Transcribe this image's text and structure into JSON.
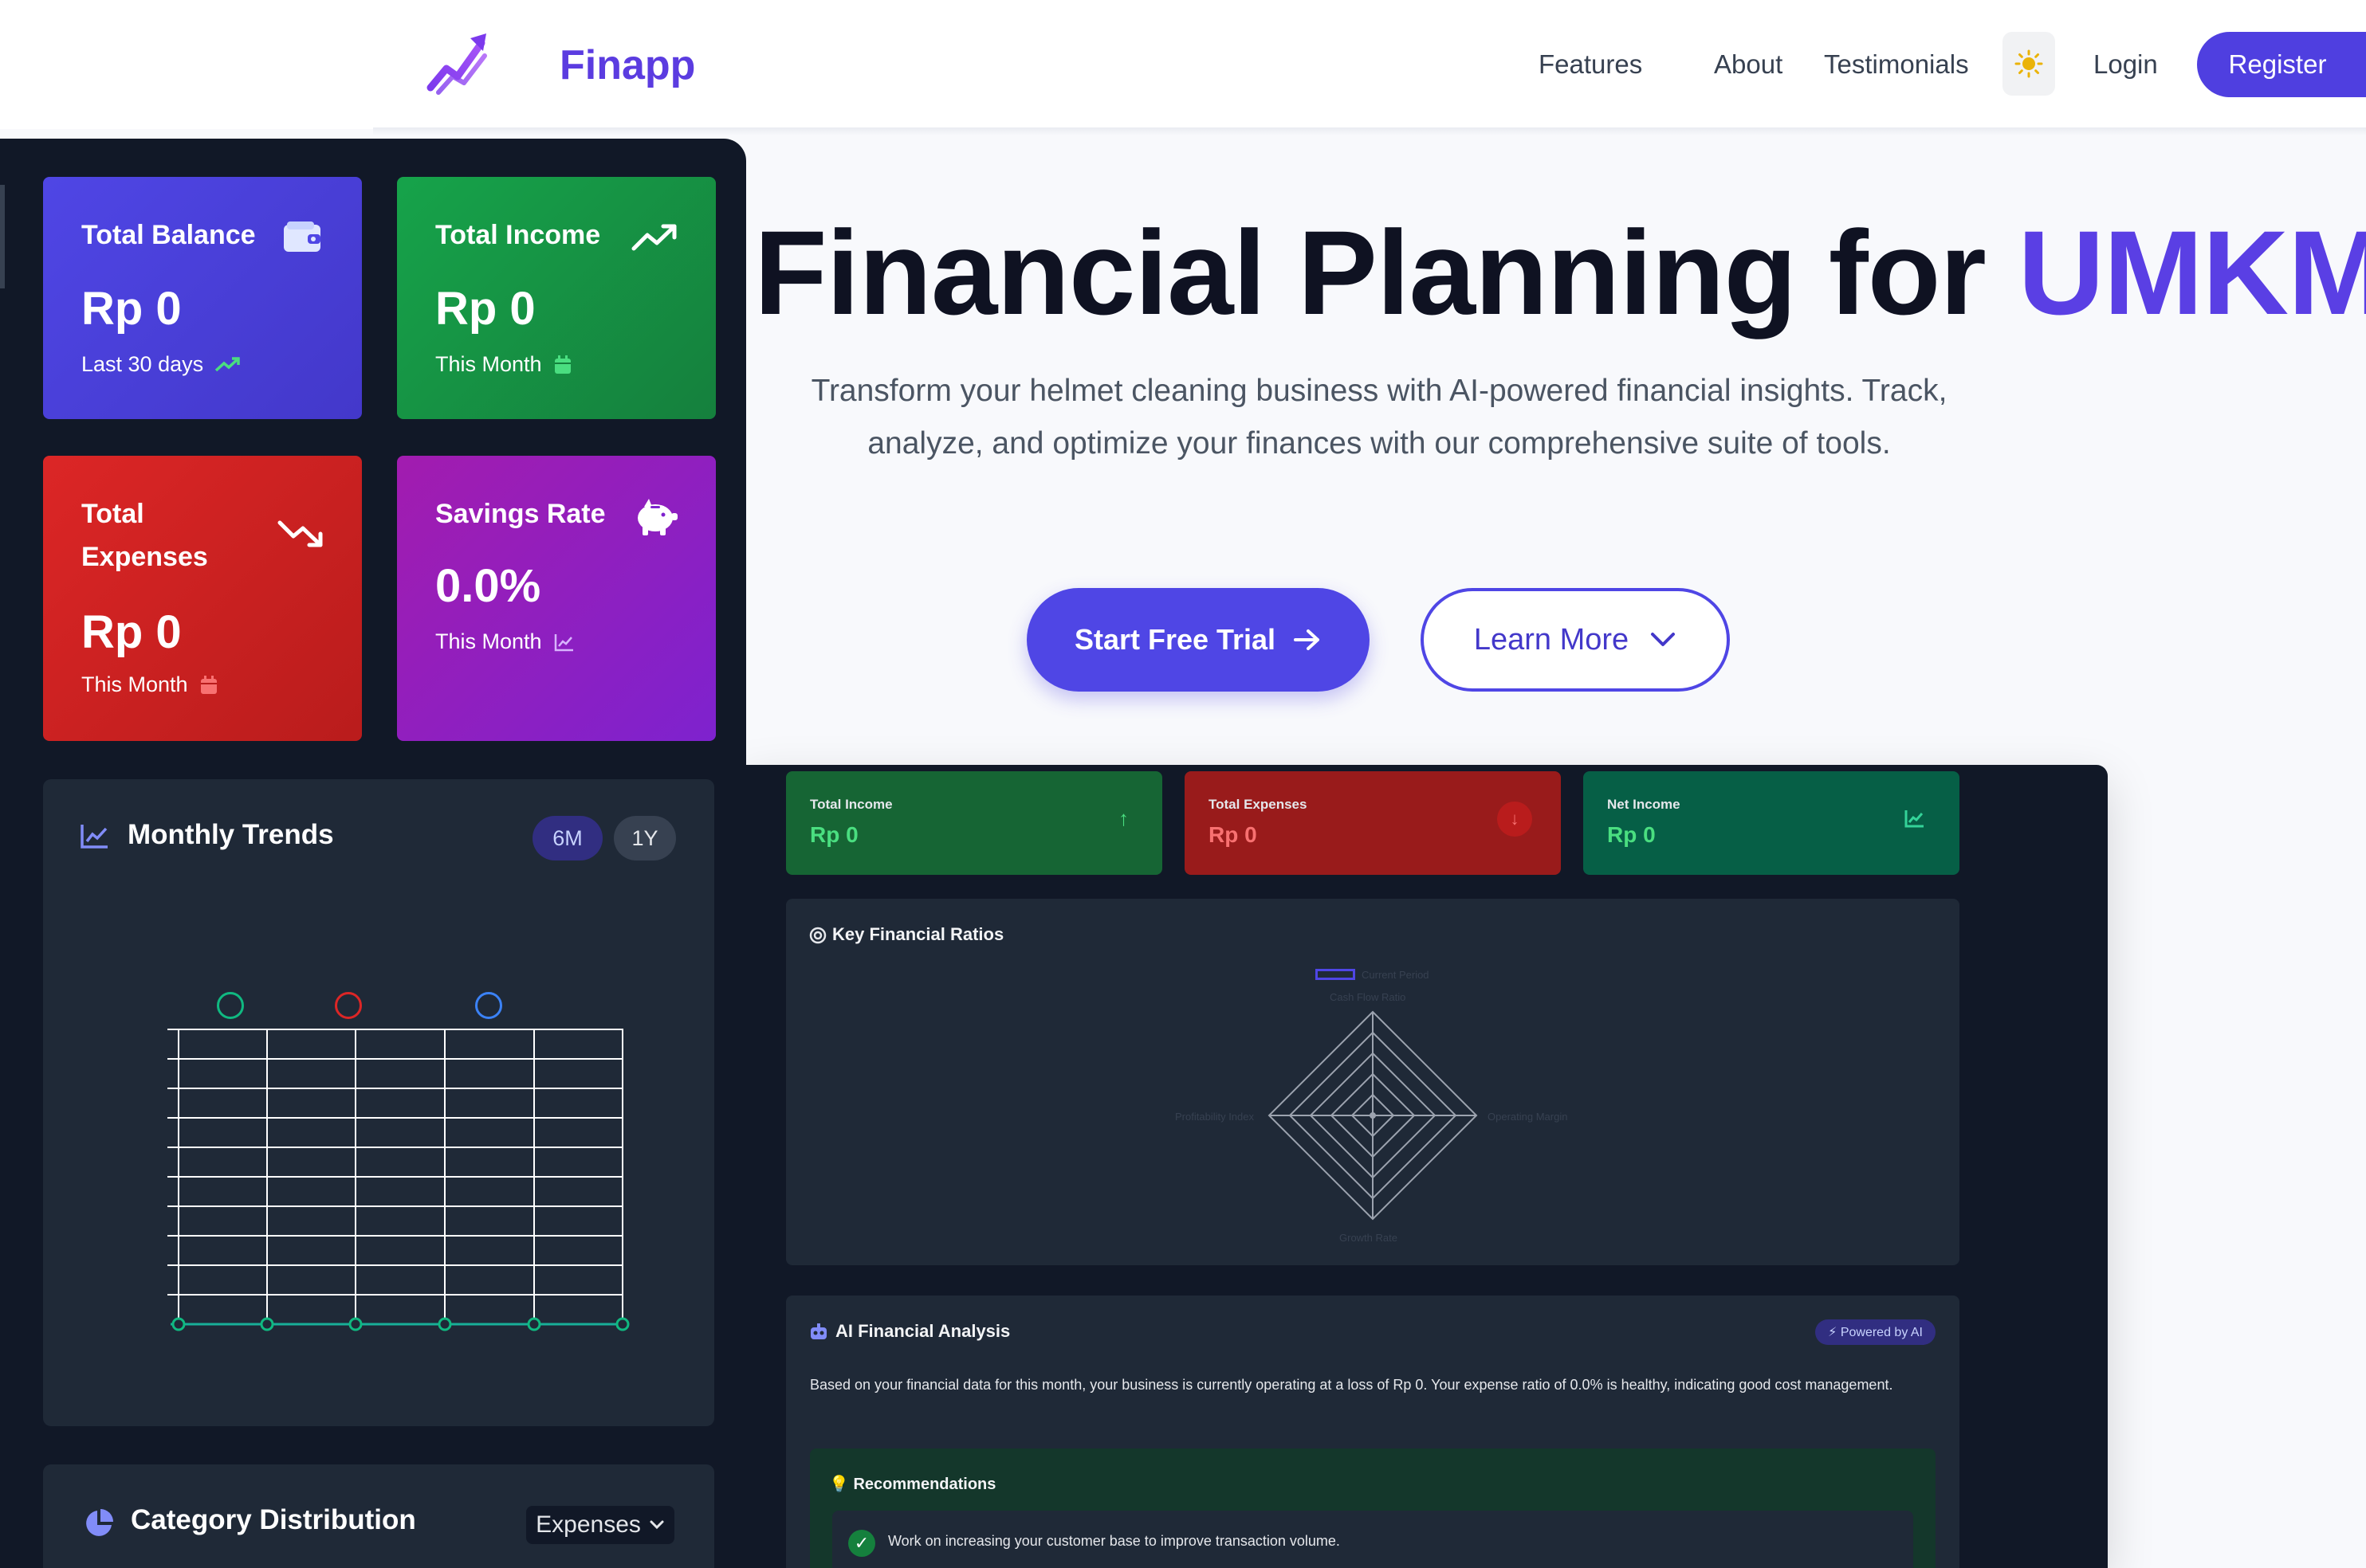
{
  "nav": {
    "brand": "Finapp",
    "links": [
      "Features",
      "About",
      "Testimonials"
    ],
    "login": "Login",
    "register": "Register"
  },
  "hero": {
    "title_main": "Financial Planning for ",
    "title_accent": "UMKM",
    "subtitle": "Transform your helmet cleaning business with AI-powered financial insights. Track, analyze, and optimize your finances with our comprehensive suite of tools.",
    "cta_primary": "Start Free Trial",
    "cta_secondary": "Learn More"
  },
  "preview": {
    "cards": [
      {
        "label": "Total Income",
        "value": "Rp 0",
        "bg": "#166534",
        "value_color": "#4ade80",
        "icon": "arrow-up-icon"
      },
      {
        "label": "Total Expenses",
        "value": "Rp 0",
        "bg": "#991b1b",
        "value_color": "#f87171",
        "icon": "arrow-down-icon"
      },
      {
        "label": "Net Income",
        "value": "Rp 0",
        "bg": "#065f46",
        "value_color": "#4ade80",
        "icon": "chart-line-icon"
      }
    ],
    "ratios_title": "Key Financial Ratios",
    "radar": {
      "legend": "Current Period",
      "labels": [
        "Cash Flow Ratio",
        "Operating Margin",
        "Growth Rate",
        "Profitability Index"
      ]
    },
    "ai_title": "AI Financial Analysis",
    "ai_badge": "⚡ Powered by AI",
    "ai_text": "Based on your financial data for this month, your business is currently operating at a loss of Rp 0. Your expense ratio of 0.0% is healthy, indicating good cost management.",
    "rec_title": "Recommendations",
    "rec_items": [
      "Work on increasing your customer base to improve transaction volume."
    ]
  },
  "sidebar": {
    "cards": [
      {
        "label": "Total Balance",
        "value": "Rp 0",
        "sub": "Last 30 days",
        "icon": "wallet-icon",
        "sub_icon": "trending-up-icon",
        "color": "#4f46e5"
      },
      {
        "label": "Total Income",
        "value": "Rp 0",
        "sub": "This Month",
        "icon": "trending-up-icon",
        "sub_icon": "calendar-icon",
        "color": "#16a34a"
      },
      {
        "label": "Total Expenses",
        "value": "Rp 0",
        "sub": "This Month",
        "icon": "trending-down-icon",
        "sub_icon": "calendar-icon",
        "color": "#dc2626"
      },
      {
        "label": "Savings Rate",
        "value": "0.0%",
        "sub": "This Month",
        "icon": "piggy-bank-icon",
        "sub_icon": "chart-line-icon",
        "color": "#9333ea"
      }
    ],
    "trends_title": "Monthly Trends",
    "range": [
      "6M",
      "1Y"
    ],
    "legend_colors": [
      "#10b981",
      "#dc2626",
      "#3b82f6"
    ],
    "category_title": "Category Distribution",
    "category_select": "Expenses"
  }
}
